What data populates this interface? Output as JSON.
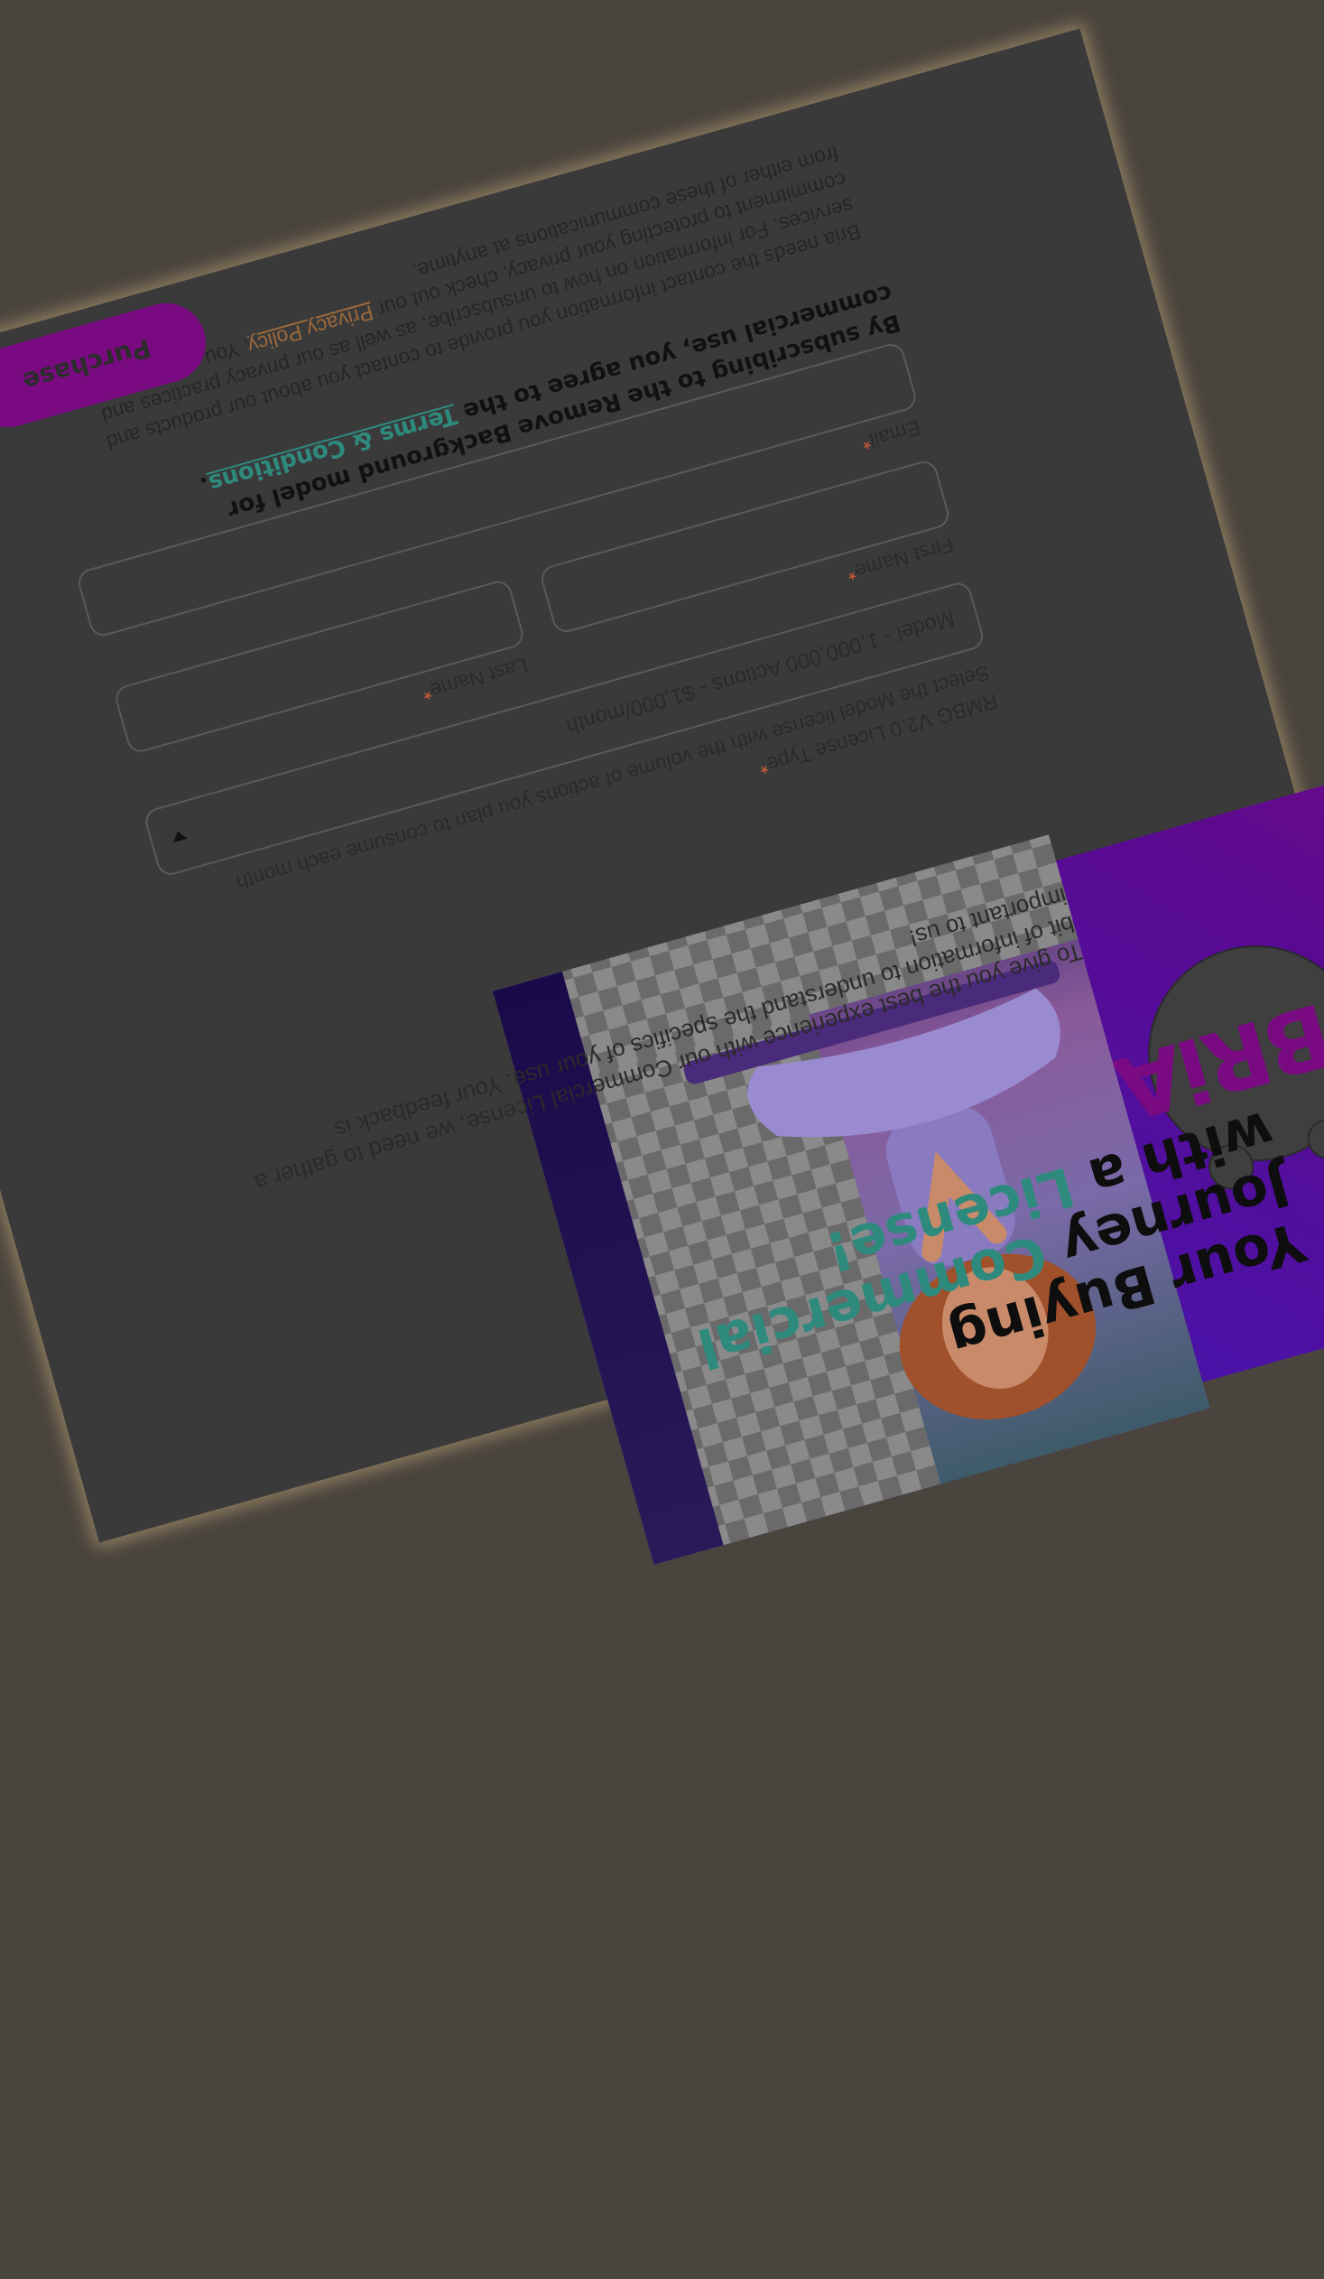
{
  "headline": {
    "line1": "Your Buying",
    "line2_lead": "Journey",
    "line2_accent": "Commercial",
    "line3_lead": "with a",
    "line3_accent": "License!"
  },
  "intro": "To give you the best experience with our Commercial License, we need to gather a bit of information to understand the specifics of your use. Your feedback is important to us!",
  "form": {
    "license_type": {
      "label": "RMBG V2.0 License Type",
      "hint": "Select the Model license with the volume of actions you plan to consume each month",
      "value": "Model - 1,000,000 Actions - $1,000/month"
    },
    "first_name": {
      "label": "First Name"
    },
    "last_name": {
      "label": "Last Name"
    },
    "email": {
      "label": "Email"
    },
    "required_mark": "*"
  },
  "terms": {
    "before": "By subscribing to the Remove Background model for commercial use, you agree to the",
    "link": "Terms & Conditions",
    "after": "."
  },
  "legal": {
    "p1": "Bria needs the contact information you provide to contact you about our products and services. For information on how to unsubscribe, as well as our privacy practices and commitment to protecting your privacy, check out our",
    "link": "Privacy Policy",
    "p2": ". You may unsubscribe from either of these communications at anytime."
  },
  "purchase_button": "Purchase",
  "logo": {
    "text": "BRiA"
  },
  "colors": {
    "accent": "#2f8a7e",
    "brand": "#7a0a82",
    "panel": "#3a3a3a"
  }
}
